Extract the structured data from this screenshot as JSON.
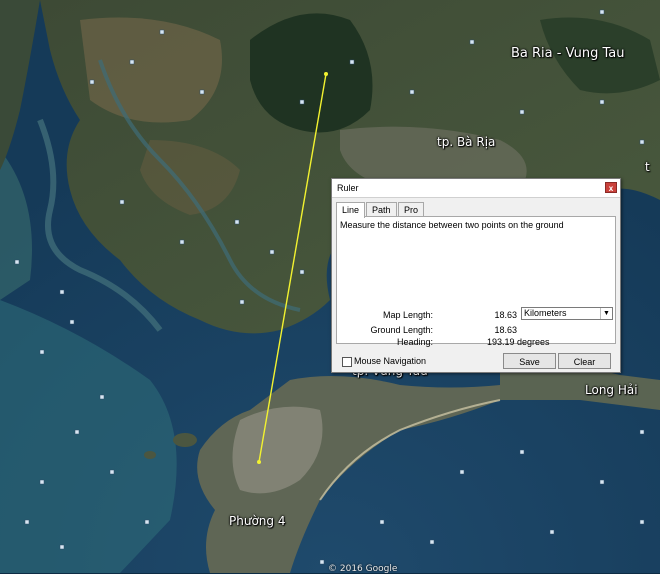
{
  "map": {
    "places": [
      {
        "name": "Ba Ria - Vung Tau",
        "size": "lg"
      },
      {
        "name": "tp. Bà Rịa",
        "size": "md"
      },
      {
        "name": "tp. Vũng Tàu",
        "size": "md"
      },
      {
        "name": "Long Hải",
        "size": "md"
      },
      {
        "name": "Phường 4",
        "size": "md"
      },
      {
        "name": "t",
        "size": "md"
      }
    ],
    "copyright": "© 2016 Google",
    "measure_line_color": "#f2f230"
  },
  "ruler": {
    "title": "Ruler",
    "close_glyph": "x",
    "tabs": [
      "Line",
      "Path",
      "Pro"
    ],
    "active_tab": "Line",
    "description": "Measure the distance between two points on the ground",
    "map_length_label": "Map Length:",
    "map_length_value": "18.63",
    "unit": "Kilometers",
    "ground_length_label": "Ground Length:",
    "ground_length_value": "18.63",
    "heading_label": "Heading:",
    "heading_value": "193.19 degrees",
    "mouse_navigation_label": "Mouse Navigation",
    "mouse_navigation_checked": false,
    "save_label": "Save",
    "clear_label": "Clear"
  }
}
